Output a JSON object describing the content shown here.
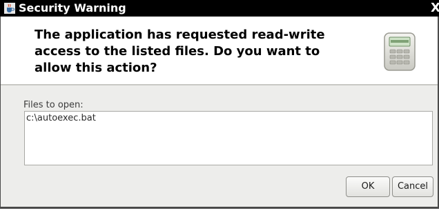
{
  "window": {
    "title": "Security Warning",
    "title_icon": "java-cup-icon",
    "close_glyph": "X"
  },
  "header": {
    "message": "The application has requested read-write\naccess to the listed files.  Do you want to\nallow this action?",
    "icon": "device-keypad-icon"
  },
  "files": {
    "label": "Files to open:",
    "items": [
      "c:\\autoexec.bat"
    ]
  },
  "buttons": {
    "ok": "OK",
    "cancel": "Cancel"
  },
  "colors": {
    "titlebar": "#000000",
    "dialog_bg": "#ededeb",
    "header_bg": "#ffffff"
  }
}
